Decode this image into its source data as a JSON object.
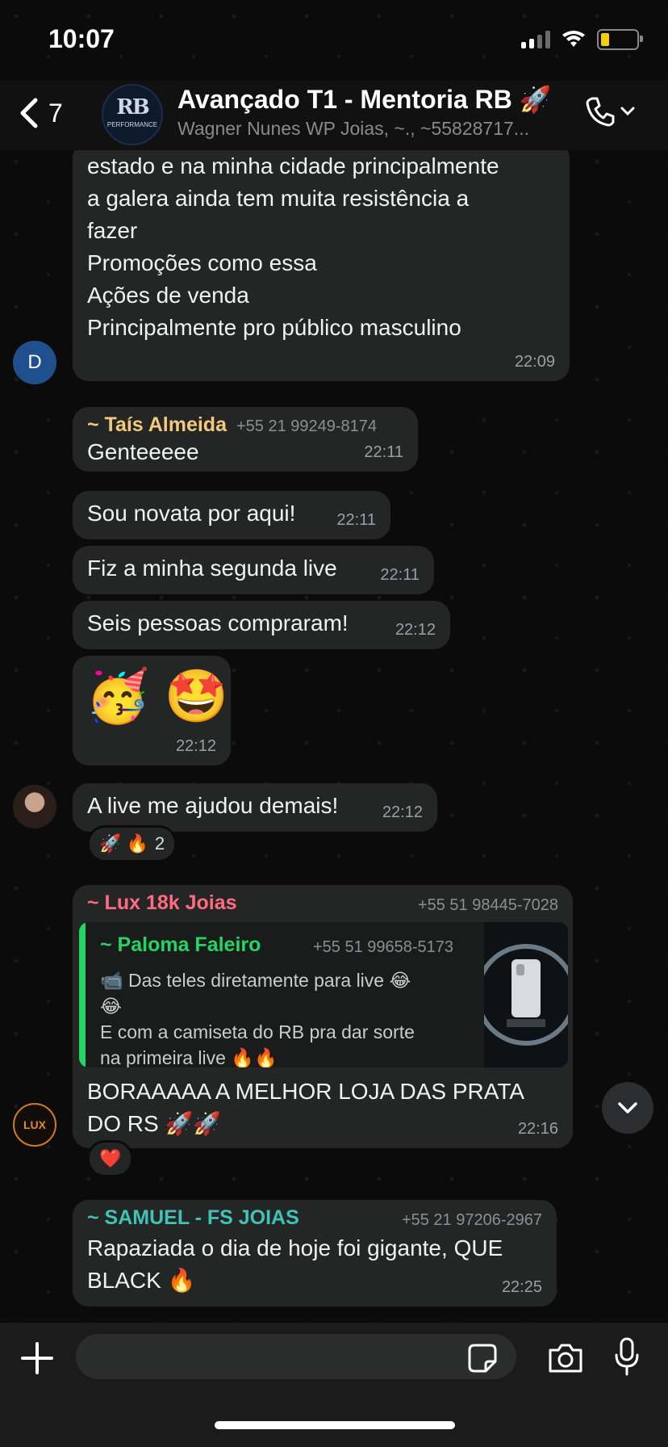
{
  "status_bar": {
    "time": "10:07"
  },
  "header": {
    "back_count": "7",
    "group_title": "Avançado T1 - Mentoria RB 🚀",
    "group_members": "Wagner Nunes WP Joias, ~., ~55828717...",
    "avatar_text": "RB",
    "avatar_subtext": "PERFORMANCE"
  },
  "messages": [
    {
      "avatar_letter": "D",
      "text": "estado e na minha cidade principalmente\na galera ainda tem muita resistência a\nfazer\nPromoções como essa\nAções de venda\nPrincipalmente pro público masculino",
      "time": "22:09"
    },
    {
      "sender": "~ Taís Almeida",
      "phone": "+55 21 99249-8174",
      "text": "Genteeeee",
      "time": "22:11"
    },
    {
      "text": "Sou novata por aqui!",
      "time": "22:11"
    },
    {
      "text": "Fiz a minha segunda live",
      "time": "22:11"
    },
    {
      "text": "Seis pessoas compraram!",
      "time": "22:12"
    },
    {
      "text": "🥳 🤩",
      "time": "22:12"
    },
    {
      "text": "A live me ajudou demais!",
      "time": "22:12",
      "reactions": "🚀 🔥",
      "reaction_count": "2"
    },
    {
      "sender": "~ Lux 18k Joias",
      "phone": "+55 51 98445-7028",
      "quote": {
        "sender": "~ Paloma Faleiro",
        "phone": "+55 51 99658-5173",
        "text": "📹 Das teles diretamente para live 😂😂\nE com a camiseta do RB pra dar sorte na primeira live 🔥🔥"
      },
      "text": "BORAAAAA A MELHOR LOJA DAS PRATA\nDO RS 🚀🚀",
      "time": "22:16",
      "reactions": "❤️"
    },
    {
      "sender": "~ SAMUEL - FS JOIAS",
      "phone": "+55 21 97206-2967",
      "text": "Rapaziada o dia de hoje foi gigante, QUE\nBLACK 🔥",
      "time": "22:25"
    }
  ],
  "input": {
    "placeholder": ""
  },
  "colors": {
    "tais": "#f5c97a",
    "lux": "#ff6b81",
    "paloma": "#25d366",
    "samuel": "#3fc3b4"
  }
}
